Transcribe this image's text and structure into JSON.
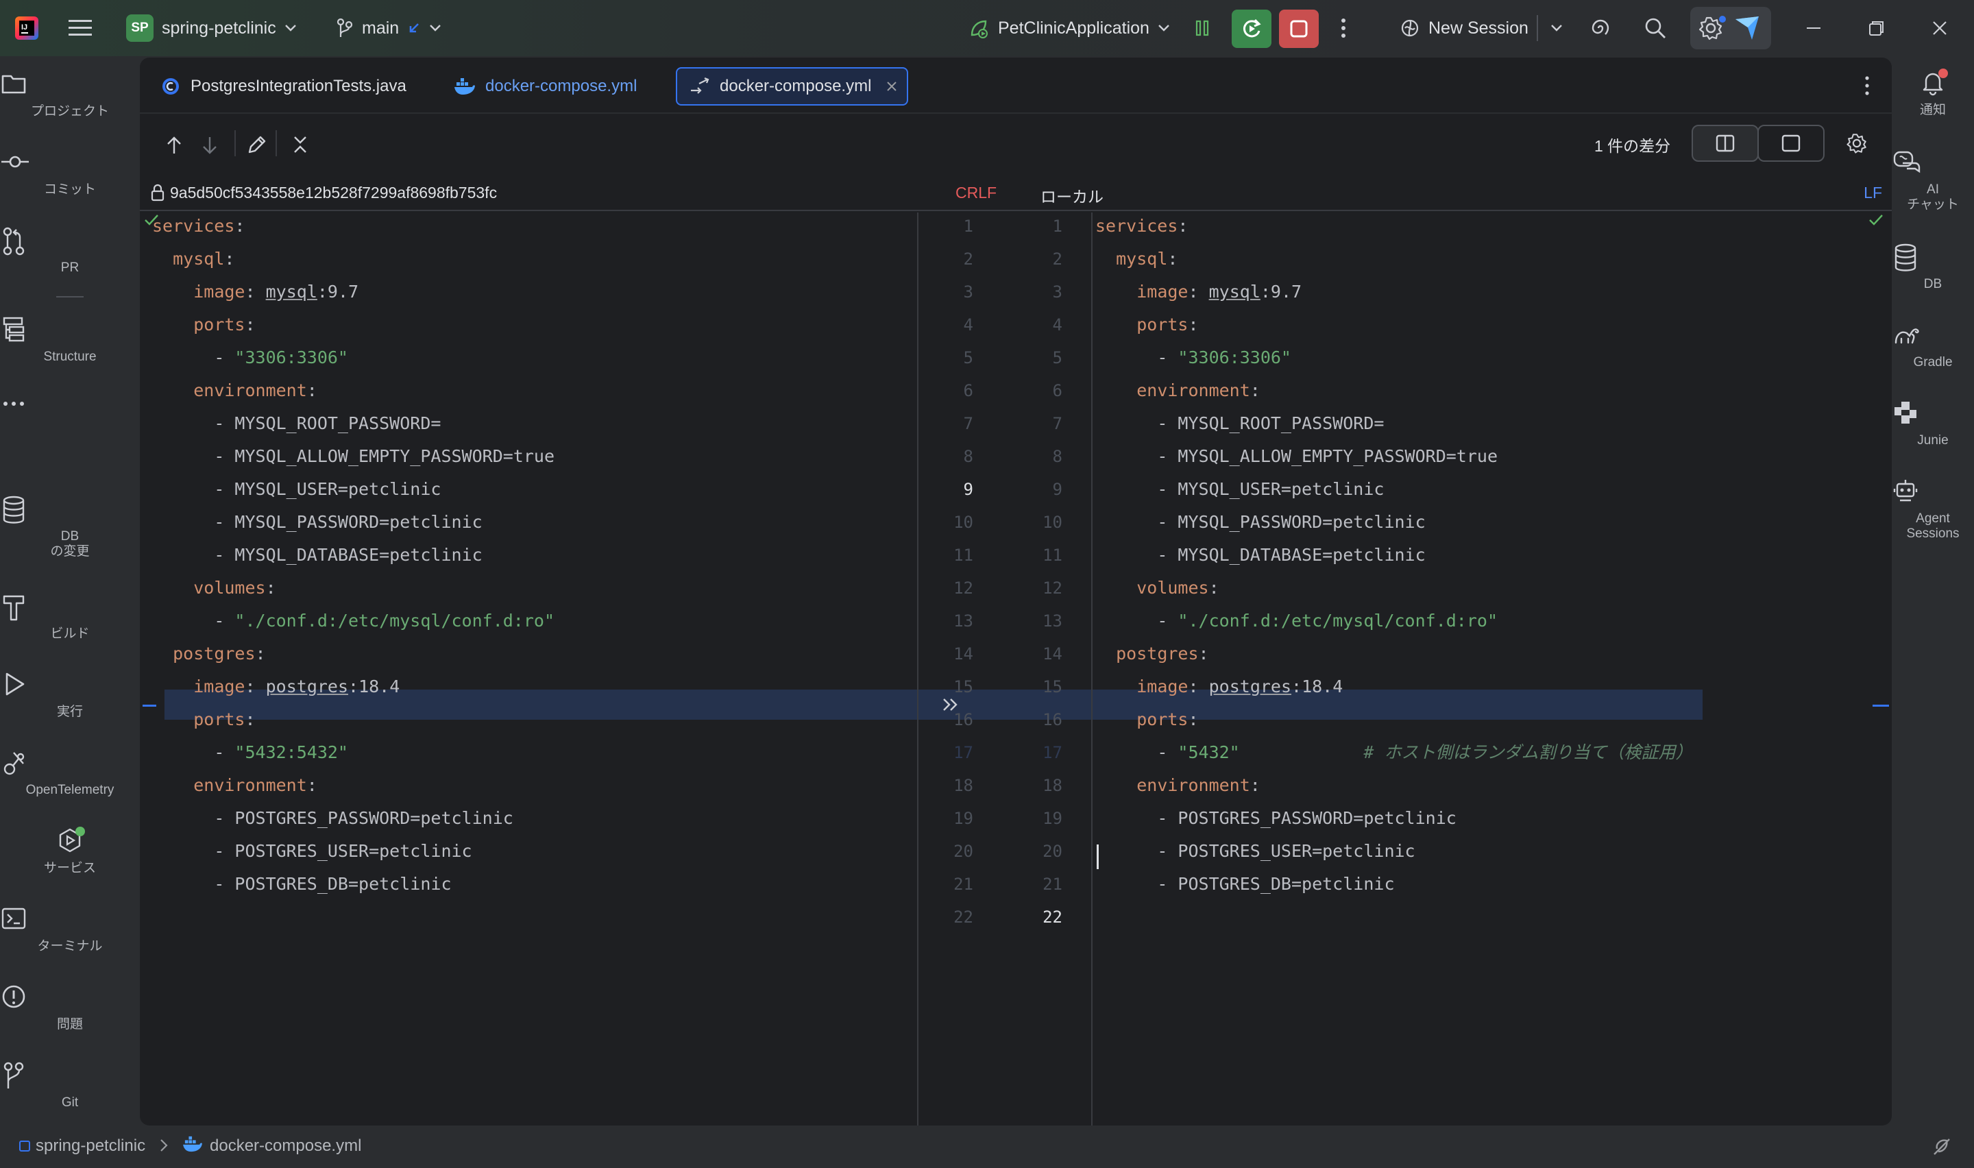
{
  "titlebar": {
    "project_badge": "SP",
    "project_name": "spring-petclinic",
    "branch": "main",
    "run_config": "PetClinicApplication",
    "new_session": "New Session"
  },
  "left_sidebar": {
    "items": [
      {
        "label": "プロジェクト",
        "icon": "folder-icon"
      },
      {
        "label": "コミット",
        "icon": "commit-icon"
      },
      {
        "label": "PR",
        "icon": "pull-request-icon"
      },
      {
        "label": "Structure",
        "icon": "structure-icon"
      },
      {
        "label": "DB\nの変更",
        "icon": "database-changes-icon"
      },
      {
        "label": "ビルド",
        "icon": "hammer-icon"
      },
      {
        "label": "実行",
        "icon": "run-icon"
      },
      {
        "label": "OpenTelemetry",
        "icon": "opentelemetry-icon"
      },
      {
        "label": "サービス",
        "icon": "services-icon"
      },
      {
        "label": "ターミナル",
        "icon": "terminal-icon"
      },
      {
        "label": "問題",
        "icon": "problems-icon"
      },
      {
        "label": "Git",
        "icon": "git-icon"
      }
    ]
  },
  "right_sidebar": {
    "items": [
      {
        "label": "通知",
        "icon": "bell-icon"
      },
      {
        "label": "AI\nチャット",
        "icon": "ai-chat-icon"
      },
      {
        "label": "DB",
        "icon": "database-icon"
      },
      {
        "label": "Gradle",
        "icon": "gradle-icon"
      },
      {
        "label": "Junie",
        "icon": "junie-icon"
      },
      {
        "label": "Agent\nSessions",
        "icon": "agent-sessions-icon"
      }
    ]
  },
  "tabs": [
    {
      "label": "PostgresIntegrationTests.java",
      "icon": "java-class-icon",
      "active": false
    },
    {
      "label": "docker-compose.yml",
      "icon": "docker-icon",
      "active": false
    },
    {
      "label": "docker-compose.yml",
      "icon": "diff-icon",
      "active": true
    }
  ],
  "diff_toolbar": {
    "diff_count": "1 件の差分"
  },
  "diff_info": {
    "left_revision": "9a5d50cf5343558e12b528f7299af8698fb753fc",
    "left_line_ending": "CRLF",
    "right_revision": "ローカル",
    "right_line_ending": "LF"
  },
  "diff": {
    "left_numbers": [
      "1",
      "2",
      "3",
      "4",
      "5",
      "6",
      "7",
      "8",
      "9",
      "10",
      "11",
      "12",
      "13",
      "14",
      "15",
      "16",
      "17",
      "18",
      "19",
      "20",
      "21",
      "22"
    ],
    "right_numbers": [
      "1",
      "2",
      "3",
      "4",
      "5",
      "6",
      "7",
      "8",
      "9",
      "10",
      "11",
      "12",
      "13",
      "14",
      "15",
      "16",
      "17",
      "18",
      "19",
      "20",
      "21",
      "22"
    ],
    "changed_line": 17,
    "left_lines": [
      "services:",
      "  mysql:",
      "    image: mysql:9.7",
      "    ports:",
      "      - \"3306:3306\"",
      "    environment:",
      "      - MYSQL_ROOT_PASSWORD=",
      "      - MYSQL_ALLOW_EMPTY_PASSWORD=true",
      "      - MYSQL_USER=petclinic",
      "      - MYSQL_PASSWORD=petclinic",
      "      - MYSQL_DATABASE=petclinic",
      "    volumes:",
      "      - \"./conf.d:/etc/mysql/conf.d:ro\"",
      "  postgres:",
      "    image: postgres:18.4",
      "    ports:",
      "      - \"5432:5432\"",
      "    environment:",
      "      - POSTGRES_PASSWORD=petclinic",
      "      - POSTGRES_USER=petclinic",
      "      - POSTGRES_DB=petclinic",
      ""
    ],
    "right_lines": [
      "services:",
      "  mysql:",
      "    image: mysql:9.7",
      "    ports:",
      "      - \"3306:3306\"",
      "    environment:",
      "      - MYSQL_ROOT_PASSWORD=",
      "      - MYSQL_ALLOW_EMPTY_PASSWORD=true",
      "      - MYSQL_USER=petclinic",
      "      - MYSQL_PASSWORD=petclinic",
      "      - MYSQL_DATABASE=petclinic",
      "    volumes:",
      "      - \"./conf.d:/etc/mysql/conf.d:ro\"",
      "  postgres:",
      "    image: postgres:18.4",
      "    ports:",
      "      - \"5432\"            # ホスト側はランダム割り当て（検証用）",
      "    environment:",
      "      - POSTGRES_PASSWORD=petclinic",
      "      - POSTGRES_USER=petclinic",
      "      - POSTGRES_DB=petclinic",
      ""
    ]
  },
  "statusbar": {
    "project": "spring-petclinic",
    "file": "docker-compose.yml"
  },
  "colors": {
    "accent": "#3574f0",
    "keyword": "#cf8e6d",
    "string": "#6aab73",
    "diff_highlight": "#25324d",
    "stop_button": "#c94f4f",
    "debug_button": "#3a8a4d"
  }
}
